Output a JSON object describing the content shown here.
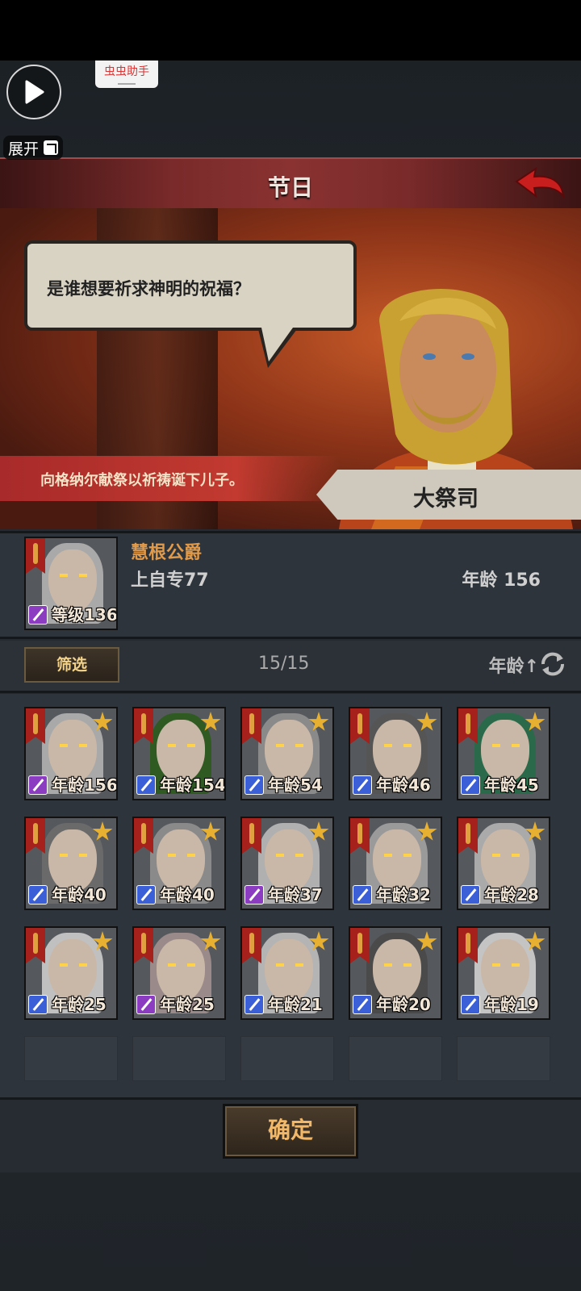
{
  "overlay": {
    "helper_label": "虫虫助手",
    "expand_label": "展开"
  },
  "header": {
    "title": "节日"
  },
  "event": {
    "speech": "是谁想要祈求神明的祝福？",
    "description": "向格纳尔献祭以祈祷诞下儿子。",
    "npc_name": "大祭司"
  },
  "selected": {
    "name": "慧根公爵",
    "subtitle": "上自专77",
    "age_text": "年龄 156",
    "level_text": "等级136"
  },
  "filter": {
    "button_label": "筛选",
    "count": "15/15",
    "sort_label": "年龄↑"
  },
  "characters": [
    {
      "age_text": "年龄156",
      "class": "purple"
    },
    {
      "age_text": "年龄154",
      "class": "blue"
    },
    {
      "age_text": "年龄54",
      "class": "blue"
    },
    {
      "age_text": "年龄46",
      "class": "blue"
    },
    {
      "age_text": "年龄45",
      "class": "blue"
    },
    {
      "age_text": "年龄40",
      "class": "blue"
    },
    {
      "age_text": "年龄40",
      "class": "blue"
    },
    {
      "age_text": "年龄37",
      "class": "purple"
    },
    {
      "age_text": "年龄32",
      "class": "blue"
    },
    {
      "age_text": "年龄28",
      "class": "blue"
    },
    {
      "age_text": "年龄25",
      "class": "blue"
    },
    {
      "age_text": "年龄25",
      "class": "purple"
    },
    {
      "age_text": "年龄21",
      "class": "blue"
    },
    {
      "age_text": "年龄20",
      "class": "blue"
    },
    {
      "age_text": "年龄19",
      "class": "blue"
    }
  ],
  "confirm_label": "确定",
  "colors": {
    "title_bar": "#7a2a2a",
    "accent_orange": "#e09a4a",
    "banner_red": "#a6201c",
    "star_gold": "#e8b030"
  }
}
